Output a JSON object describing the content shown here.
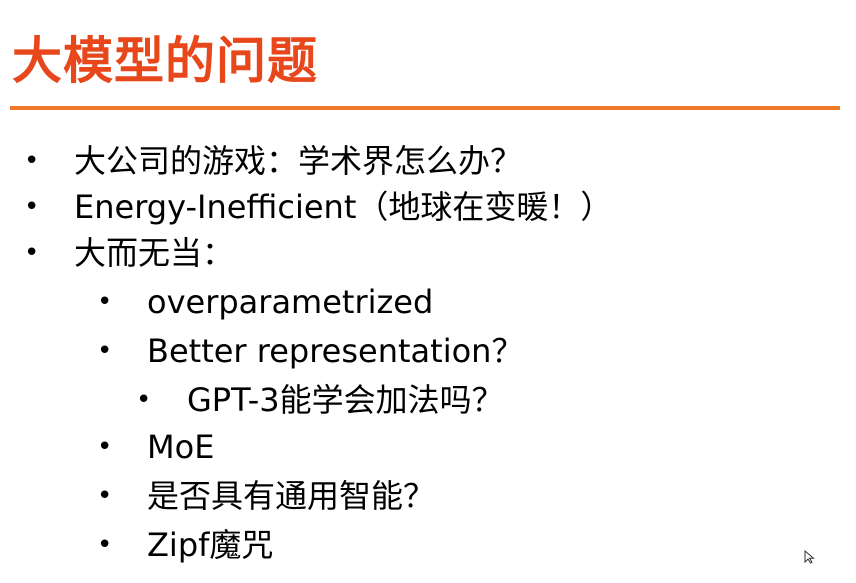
{
  "title": "大模型的问题",
  "colors": {
    "title": "#e8471b",
    "rule": "#f07a2a",
    "text": "#000000"
  },
  "bullets": [
    {
      "level": 1,
      "text": "大公司的游戏：学术界怎么办？"
    },
    {
      "level": 1,
      "text": "Energy-Inefficient（地球在变暖！）"
    },
    {
      "level": 1,
      "text": "大而无当："
    },
    {
      "level": 2,
      "text": "overparametrized"
    },
    {
      "level": 2,
      "text": "Better representation？"
    },
    {
      "level": 3,
      "text": "GPT-3能学会加法吗？"
    },
    {
      "level": 2,
      "text": "MoE"
    },
    {
      "level": 2,
      "text": "是否具有通用智能？"
    },
    {
      "level": 2,
      "text": "Zipf魔咒"
    }
  ],
  "bullet_glyph": "•",
  "cursor_icon": "mouse-pointer-icon"
}
